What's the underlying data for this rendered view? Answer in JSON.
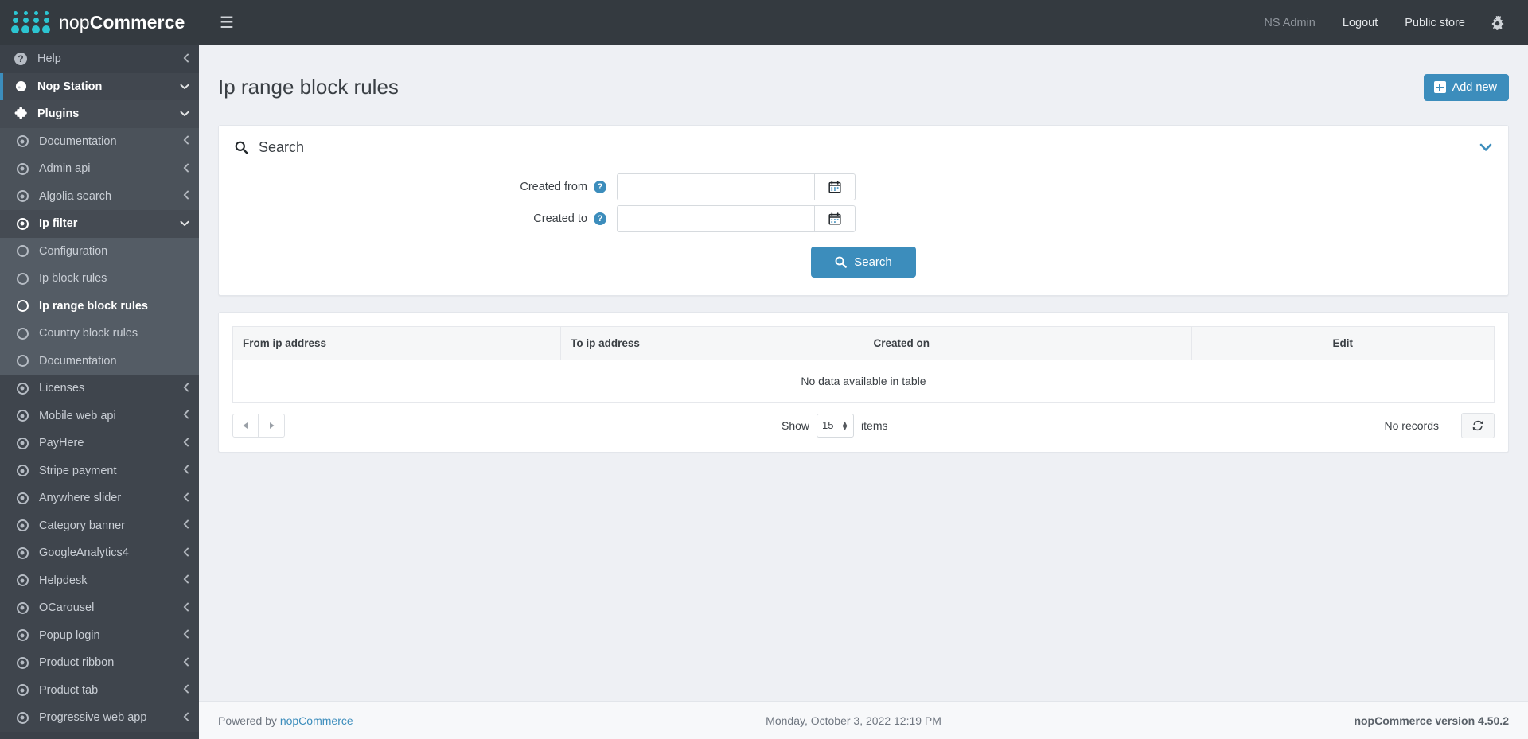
{
  "brand": {
    "name_light": "nop",
    "name_bold": "Commerce"
  },
  "navbar": {
    "hamburger_icon": "hamburger-icon",
    "links": [
      {
        "label": "NS Admin",
        "muted": true
      },
      {
        "label": "Logout",
        "muted": false
      },
      {
        "label": "Public store",
        "muted": false
      }
    ],
    "gear_icon": "gears-icon"
  },
  "sidebar": {
    "items": [
      {
        "label": "Help",
        "icon": "help-circle-icon",
        "level": 0,
        "state": "collapsed",
        "chevron": "chevron-left"
      },
      {
        "label": "Nop Station",
        "icon": "moon-icon",
        "level": 0,
        "state": "open-accent",
        "chevron": "chevron-down"
      },
      {
        "label": "Plugins",
        "icon": "puzzle-icon",
        "level": 0,
        "state": "open",
        "chevron": "chevron-down"
      },
      {
        "label": "Documentation",
        "icon": "circle-dot-icon",
        "level": 1,
        "state": "collapsed",
        "chevron": "chevron-left"
      },
      {
        "label": "Admin api",
        "icon": "circle-dot-icon",
        "level": 1,
        "state": "collapsed",
        "chevron": "chevron-left"
      },
      {
        "label": "Algolia search",
        "icon": "circle-dot-icon",
        "level": 1,
        "state": "collapsed",
        "chevron": "chevron-left"
      },
      {
        "label": "Ip filter",
        "icon": "circle-dot-icon",
        "level": 1,
        "state": "expanded",
        "chevron": "chevron-down"
      },
      {
        "label": "Configuration",
        "icon": "ring-icon",
        "level": 2,
        "state": "normal",
        "chevron": ""
      },
      {
        "label": "Ip block rules",
        "icon": "ring-icon",
        "level": 2,
        "state": "normal",
        "chevron": ""
      },
      {
        "label": "Ip range block rules",
        "icon": "ring-icon",
        "level": 2,
        "state": "current",
        "chevron": ""
      },
      {
        "label": "Country block rules",
        "icon": "ring-icon",
        "level": 2,
        "state": "normal",
        "chevron": ""
      },
      {
        "label": "Documentation",
        "icon": "ring-icon",
        "level": 2,
        "state": "normal",
        "chevron": ""
      },
      {
        "label": "Licenses",
        "icon": "circle-dot-icon",
        "level": 1,
        "state": "collapsed",
        "chevron": "chevron-left"
      },
      {
        "label": "Mobile web api",
        "icon": "circle-dot-icon",
        "level": 1,
        "state": "collapsed",
        "chevron": "chevron-left"
      },
      {
        "label": "PayHere",
        "icon": "circle-dot-icon",
        "level": 1,
        "state": "collapsed",
        "chevron": "chevron-left"
      },
      {
        "label": "Stripe payment",
        "icon": "circle-dot-icon",
        "level": 1,
        "state": "collapsed",
        "chevron": "chevron-left"
      },
      {
        "label": "Anywhere slider",
        "icon": "circle-dot-icon",
        "level": 1,
        "state": "collapsed",
        "chevron": "chevron-left"
      },
      {
        "label": "Category banner",
        "icon": "circle-dot-icon",
        "level": 1,
        "state": "collapsed",
        "chevron": "chevron-left"
      },
      {
        "label": "GoogleAnalytics4",
        "icon": "circle-dot-icon",
        "level": 1,
        "state": "collapsed",
        "chevron": "chevron-left"
      },
      {
        "label": "Helpdesk",
        "icon": "circle-dot-icon",
        "level": 1,
        "state": "collapsed",
        "chevron": "chevron-left"
      },
      {
        "label": "OCarousel",
        "icon": "circle-dot-icon",
        "level": 1,
        "state": "collapsed",
        "chevron": "chevron-left"
      },
      {
        "label": "Popup login",
        "icon": "circle-dot-icon",
        "level": 1,
        "state": "collapsed",
        "chevron": "chevron-left"
      },
      {
        "label": "Product ribbon",
        "icon": "circle-dot-icon",
        "level": 1,
        "state": "collapsed",
        "chevron": "chevron-left"
      },
      {
        "label": "Product tab",
        "icon": "circle-dot-icon",
        "level": 1,
        "state": "collapsed",
        "chevron": "chevron-left"
      },
      {
        "label": "Progressive web app",
        "icon": "circle-dot-icon",
        "level": 1,
        "state": "collapsed",
        "chevron": "chevron-left"
      }
    ]
  },
  "page": {
    "title": "Ip range block rules",
    "add_new_label": "Add new"
  },
  "search_panel": {
    "title": "Search",
    "search_icon": "magnifier-icon",
    "collapse_icon": "chevron-down-icon",
    "fields": [
      {
        "label": "Created from",
        "value": "",
        "placeholder": "",
        "help_icon": "question-circle-icon",
        "calendar_icon": "calendar-icon"
      },
      {
        "label": "Created to",
        "value": "",
        "placeholder": "",
        "help_icon": "question-circle-icon",
        "calendar_icon": "calendar-icon"
      }
    ],
    "search_button_label": "Search"
  },
  "table": {
    "columns": [
      "From ip address",
      "To ip address",
      "Created on",
      "Edit"
    ],
    "rows": [],
    "empty_text": "No data available in table"
  },
  "table_footer": {
    "prev_icon": "triangle-left-icon",
    "next_icon": "triangle-right-icon",
    "show_label": "Show",
    "page_size": "15",
    "items_label": "items",
    "records_text": "No records",
    "refresh_icon": "refresh-icon"
  },
  "footer": {
    "powered_by": "Powered by",
    "powered_link": "nopCommerce",
    "date": "Monday, October 3, 2022 12:19 PM",
    "version": "nopCommerce version 4.50.2"
  },
  "colors": {
    "accent": "#3c8dbc",
    "sidebar_bg": "#3b4149",
    "navbar_bg": "#343a40",
    "logo_cyan": "#2cc5d2",
    "content_bg": "#eef0f4"
  }
}
